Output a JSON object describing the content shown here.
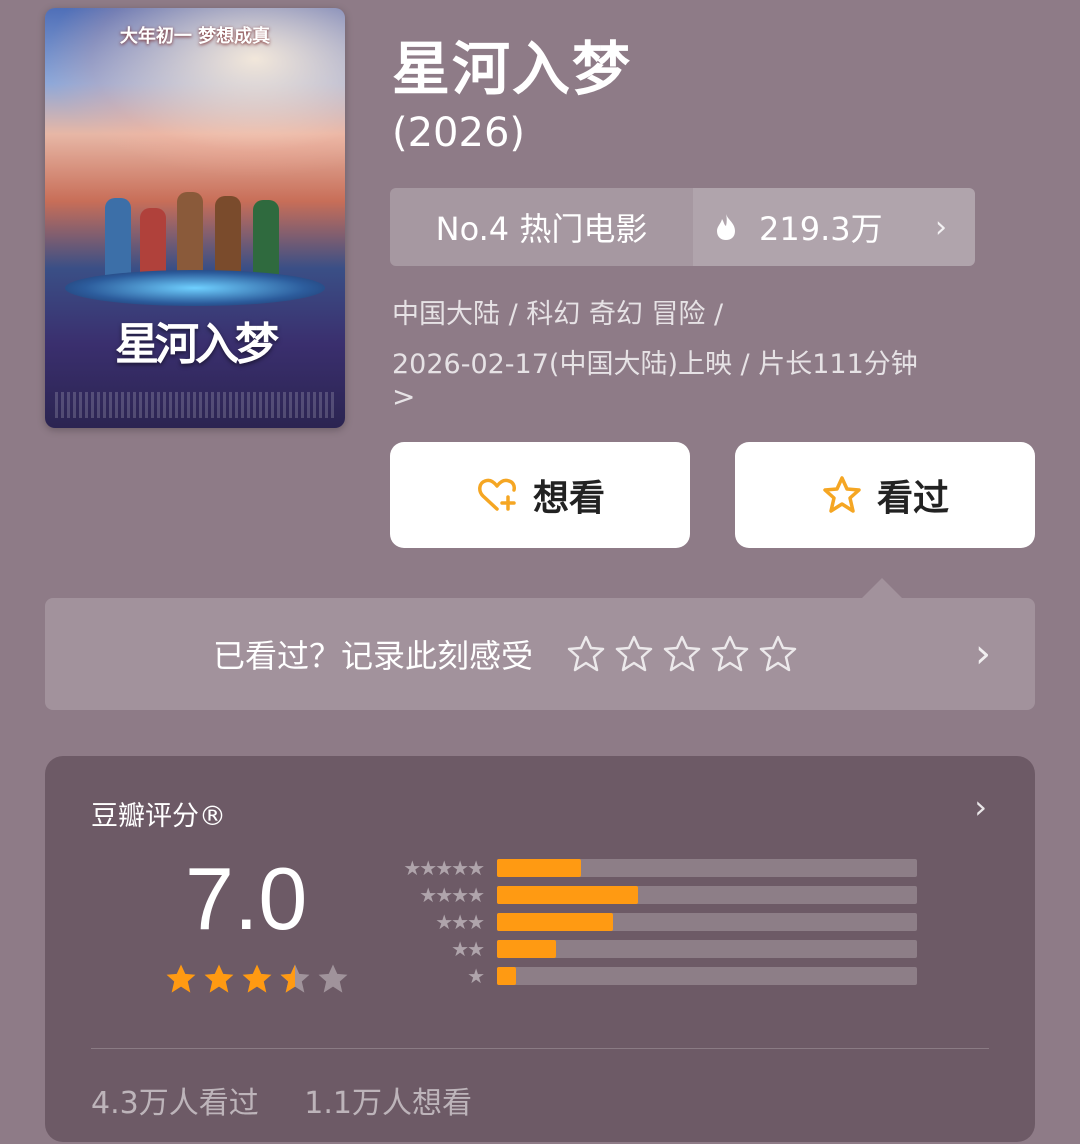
{
  "movie": {
    "title": "星河入梦",
    "year": "(2026)",
    "poster": {
      "tagline": "大年初一 梦想成真",
      "title_art": "星河入梦"
    }
  },
  "rank": {
    "label": "No.4 热门电影",
    "heat": "219.3万",
    "icon": "fire-icon"
  },
  "meta": {
    "line1": "中国大陆 / 科幻 奇幻 冒险 /",
    "line2": "2026-02-17(中国大陆)上映 / 片长111分钟",
    "more": ">"
  },
  "actions": {
    "want_label": "想看",
    "seen_label": "看过"
  },
  "record": {
    "prompt": "已看过？记录此刻感受",
    "stars": 5
  },
  "rating": {
    "label": "豆瓣评分®",
    "score": "7.0",
    "star_value": 3.5,
    "distribution": [
      {
        "stars": "★★★★★",
        "fraction": 0.2
      },
      {
        "stars": "★★★★",
        "fraction": 0.335
      },
      {
        "stars": "★★★",
        "fraction": 0.275
      },
      {
        "stars": "★★",
        "fraction": 0.14
      },
      {
        "stars": "★",
        "fraction": 0.045
      }
    ],
    "seen_count": "4.3万人看过",
    "want_count": "1.1万人想看"
  },
  "colors": {
    "background": "#8e7b87",
    "card": "#6d5a66",
    "accent": "#ff9a12",
    "icon_accent": "#f5a623"
  }
}
